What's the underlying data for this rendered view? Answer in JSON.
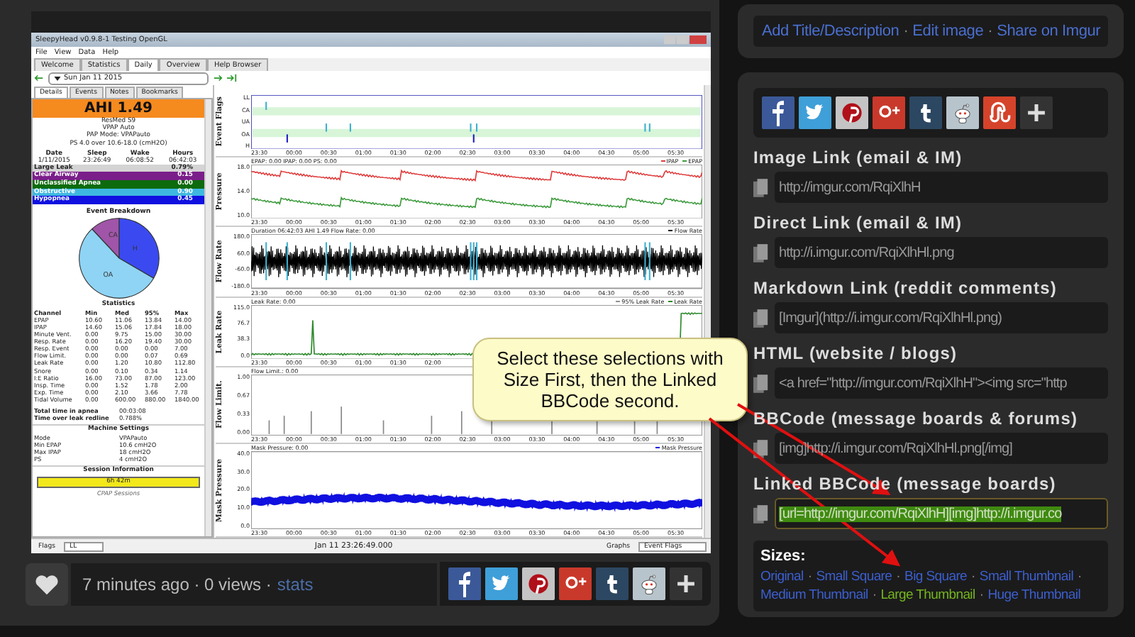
{
  "app": {
    "title": "SleepyHead v0.9.8-1 Testing OpenGL",
    "menu": [
      "File",
      "View",
      "Data",
      "Help"
    ],
    "tabs": [
      {
        "label": "Welcome",
        "selected": false
      },
      {
        "label": "Statistics",
        "selected": false
      },
      {
        "label": "Daily",
        "selected": true
      },
      {
        "label": "Overview",
        "selected": false
      },
      {
        "label": "Help Browser",
        "selected": false
      }
    ],
    "date": "Sun Jan 11 2015",
    "subtabs": [
      {
        "label": "Details",
        "selected": true
      },
      {
        "label": "Events",
        "selected": false
      },
      {
        "label": "Notes",
        "selected": false
      },
      {
        "label": "Bookmarks",
        "selected": false
      }
    ],
    "ahi": "AHI 1.49",
    "machine_lines": [
      "ResMed S9",
      "VPAP Auto",
      "PAP Mode: VPAPauto",
      "PS 4.0 over 10.6-18.0 (cmH2O)"
    ],
    "session_columns": [
      "Date",
      "Sleep",
      "Wake",
      "Hours"
    ],
    "session_values": [
      "1/11/2015",
      "23:26:49",
      "06:08:52",
      "06:42:03"
    ],
    "indices": [
      {
        "label": "Large Leak",
        "value": "0.79%",
        "color": "#d4d4d4"
      },
      {
        "label": "Clear Airway",
        "value": "0.15",
        "color": "#7a1f8a"
      },
      {
        "label": "Unclassified Apnea",
        "value": "0.00",
        "color": "#0d6b0d"
      },
      {
        "label": "Obstructive",
        "value": "0.90",
        "color": "#3fb8e0"
      },
      {
        "label": "Hypopnea",
        "value": "0.45",
        "color": "#1010e0"
      }
    ],
    "pie": {
      "title": "Event Breakdown",
      "labels": [
        "CA",
        "H",
        "OA"
      ]
    },
    "stats_title": "Statistics",
    "stats_columns": [
      "Channel",
      "Min",
      "Med",
      "95%",
      "Max"
    ],
    "stats_rows": [
      [
        "EPAP",
        "10.60",
        "11.06",
        "13.84",
        "14.00"
      ],
      [
        "IPAP",
        "14.60",
        "15.06",
        "17.84",
        "18.00"
      ],
      [
        "Minute Vent.",
        "0.00",
        "9.75",
        "15.00",
        "30.00"
      ],
      [
        "Resp. Rate",
        "0.00",
        "16.20",
        "19.40",
        "30.00"
      ],
      [
        "Resp. Event",
        "0.00",
        "0.00",
        "0.00",
        "7.00"
      ],
      [
        "Flow Limit.",
        "0.00",
        "0.00",
        "0.07",
        "0.69"
      ],
      [
        "Leak Rate",
        "0.00",
        "1.20",
        "10.80",
        "112.80"
      ],
      [
        "Snore",
        "0.00",
        "0.10",
        "0.34",
        "1.14"
      ],
      [
        "I:E Ratio",
        "16.00",
        "73.00",
        "87.00",
        "123.00"
      ],
      [
        "Insp. Time",
        "0.00",
        "1.52",
        "1.78",
        "2.00"
      ],
      [
        "Exp. Time",
        "0.00",
        "2.10",
        "3.66",
        "7.78"
      ],
      [
        "Tidal Volume",
        "0.00",
        "600.00",
        "880.00",
        "1840.00"
      ]
    ],
    "totals": [
      [
        "Total time in apnea",
        "00:03:08"
      ],
      [
        "Time over leak redline",
        "0.788%"
      ]
    ],
    "settings_title": "Machine Settings",
    "settings": [
      [
        "Mode",
        "VPAPauto"
      ],
      [
        "Min EPAP",
        "10.6 cmH2O"
      ],
      [
        "Max IPAP",
        "18 cmH2O"
      ],
      [
        "PS",
        "4 cmH2O"
      ]
    ],
    "session_title": "Session Information",
    "session_bar": "6h 42m",
    "sessions_label": "CPAP Sessions",
    "graphs": [
      {
        "kind": "flags",
        "title": "Event Flags",
        "y_ticks": [
          "LL",
          "CA",
          "UA",
          "OA",
          "H"
        ],
        "x_ticks": [
          "23:30",
          "00:00",
          "00:30",
          "01:00",
          "01:30",
          "02:00",
          "02:30",
          "03:00",
          "03:30",
          "04:00",
          "04:30",
          "05:00",
          "05:30"
        ]
      },
      {
        "kind": "pressure",
        "title": "Pressure",
        "header": "EPAP: 0.00 IPAP: 0.00 PS: 0.00",
        "legend": [
          {
            "label": "IPAP",
            "color": "#e03c3c"
          },
          {
            "label": "EPAP",
            "color": "#3c9a3c"
          }
        ],
        "y_ticks": [
          "18.0",
          "14.0",
          "10.0"
        ],
        "x_ticks": [
          "23:30",
          "00:00",
          "00:30",
          "01:00",
          "01:30",
          "02:00",
          "02:30",
          "03:00",
          "03:30",
          "04:00",
          "04:30",
          "05:00",
          "05:30"
        ]
      },
      {
        "kind": "flow",
        "title": "Flow Rate",
        "header": "Duration 06:42:03 AHI 1.49 Flow Rate: 0.00",
        "legend": [
          {
            "label": "Flow Rate",
            "color": "#000000"
          }
        ],
        "y_ticks": [
          "180.0",
          "60.0",
          "-60.0",
          "-180.0"
        ],
        "x_ticks": [
          "23:30",
          "00:00",
          "00:30",
          "01:00",
          "01:30",
          "02:00",
          "02:30",
          "03:00",
          "03:30",
          "04:00",
          "04:30",
          "05:00",
          "05:30"
        ]
      },
      {
        "kind": "leak",
        "title": "Leak Rate",
        "header": "Leak Rate: 0.00",
        "legend": [
          {
            "label": "95% Leak Rate",
            "color": "#909090"
          },
          {
            "label": "Leak Rate",
            "color": "#2e8b2e"
          }
        ],
        "y_ticks": [
          "115.0",
          "76.7",
          "38.3",
          "0.0"
        ],
        "x_ticks": [
          "23:30",
          "00:00",
          "00:30",
          "01:00",
          "01:30",
          "02:00"
        ]
      },
      {
        "kind": "flowlimit",
        "title": "Flow Limit.",
        "header": "Flow Limit.: 0.00",
        "y_ticks": [
          "1.00",
          "0.67",
          "0.33",
          "0.00"
        ],
        "x_ticks": [
          "23:30",
          "00:00",
          "00:30",
          "01:00",
          "01:30",
          "02:00",
          "02:30",
          "03:00",
          "03:30",
          "04:00",
          "04:30",
          "05:00",
          "05:30"
        ]
      },
      {
        "kind": "mask",
        "title": "Mask Pressure",
        "header": "Mask Pressure: 0.00",
        "legend": [
          {
            "label": "Mask Pressure",
            "color": "#1010e0"
          }
        ],
        "y_ticks": [
          "40.0",
          "30.0",
          "20.0",
          "10.0",
          "0.0"
        ],
        "x_ticks": [
          "23:30",
          "00:00",
          "00:30",
          "01:00",
          "01:30",
          "02:00",
          "02:30",
          "03:00",
          "03:30",
          "04:00",
          "04:30",
          "05:00",
          "05:30"
        ]
      }
    ],
    "footer": {
      "flags": "Flags",
      "flags_value": "LL",
      "timestamp": "Jan 11 23:26:49.000",
      "graphs": "Graphs",
      "graphs_value": "Event Flags"
    }
  },
  "post": {
    "meta": "7 minutes ago · 0 views ·",
    "stats": "stats",
    "share": [
      {
        "kind": "facebook"
      },
      {
        "kind": "twitter"
      },
      {
        "kind": "pinterest"
      },
      {
        "kind": "googleplus"
      },
      {
        "kind": "tumblr"
      },
      {
        "kind": "reddit"
      },
      {
        "kind": "more"
      }
    ]
  },
  "actions": {
    "links": [
      "Add Title/Description",
      "Edit image",
      "Share on Imgur"
    ],
    "separator": "·"
  },
  "share": [
    {
      "kind": "facebook"
    },
    {
      "kind": "twitter"
    },
    {
      "kind": "pinterest"
    },
    {
      "kind": "googleplus"
    },
    {
      "kind": "tumblr"
    },
    {
      "kind": "reddit"
    },
    {
      "kind": "stumbleupon"
    },
    {
      "kind": "more"
    }
  ],
  "embed_codes": [
    {
      "label": "Image Link (email & IM)",
      "value": "http://imgur.com/RqiXlhH",
      "selected": false
    },
    {
      "label": "Direct Link (email & IM)",
      "value": "http://i.imgur.com/RqiXlhHl.png",
      "selected": false
    },
    {
      "label": "Markdown Link (reddit comments)",
      "value": "[Imgur](http://i.imgur.com/RqiXlhHl.png)",
      "selected": false
    },
    {
      "label": "HTML (website / blogs)",
      "value": "<a href=\"http://imgur.com/RqiXlhH\"><img src=\"http",
      "selected": false
    },
    {
      "label": "BBCode (message boards & forums)",
      "value": "[img]http://i.imgur.com/RqiXlhHl.png[/img]",
      "selected": false
    },
    {
      "label": "Linked BBCode (message boards)",
      "value": "[url=http://imgur.com/RqiXlhH][img]http://i.imgur.co",
      "selected": true
    }
  ],
  "sizes": {
    "label": "Sizes:",
    "separator": "·",
    "options": [
      {
        "label": "Original",
        "selected": false
      },
      {
        "label": "Small Square",
        "selected": false
      },
      {
        "label": "Big Square",
        "selected": false
      },
      {
        "label": "Small Thumbnail",
        "selected": false
      },
      {
        "label": "Medium Thumbnail",
        "selected": false
      },
      {
        "label": "Large Thumbnail",
        "selected": true
      },
      {
        "label": "Huge Thumbnail",
        "selected": false
      }
    ]
  },
  "callout": "Select these selections with Size First, then the Linked BBCode second."
}
